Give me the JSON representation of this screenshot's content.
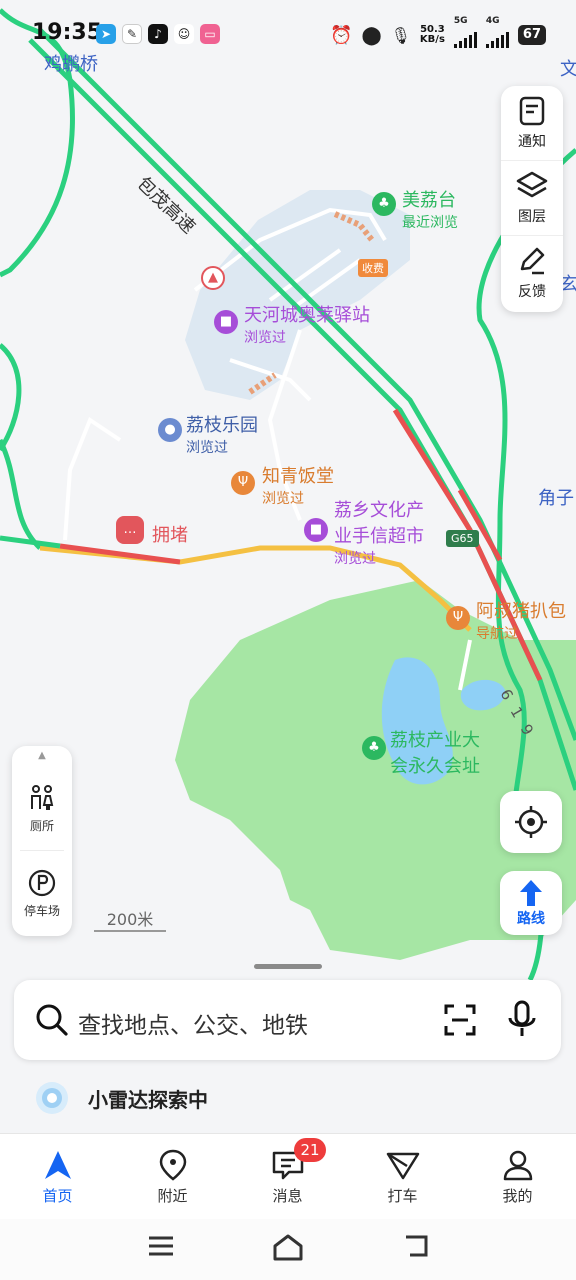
{
  "status_bar": {
    "time": "19:35",
    "network_speed": "50.3",
    "network_unit": "KB/s",
    "signal1": "5G",
    "signal2": "4G",
    "battery": "67"
  },
  "map": {
    "place_labels": {
      "jiye_bridge": "鸡鹕桥",
      "expressway": "包茂高速",
      "meilitai_name": "美荔台",
      "meilitai_sub": "最近浏览",
      "toll": "收费",
      "tianhe_name": "天河城奥莱驿站",
      "tianhe_sub": "浏览过",
      "lizhi_park_name": "荔枝乐园",
      "lizhi_park_sub": "浏览过",
      "zhiqing_name": "知青饭堂",
      "zhiqing_sub": "浏览过",
      "culture_line1": "荔乡文化产",
      "culture_line2": "业手信超市",
      "culture_sub": "浏览过",
      "congestion": "拥堵",
      "g65": "G65",
      "pork_name": "阿叔猪扒包",
      "pork_sub": "导航过",
      "industry_line1": "荔枝产业大",
      "industry_line2": "会永久会址",
      "edge_right_top": "文",
      "edge_right_mid": "玄",
      "edge_right_low": "角子",
      "road_number": "6 1 9"
    },
    "scale": "200米"
  },
  "tools": [
    {
      "label": "通知",
      "icon": "notification-icon"
    },
    {
      "label": "图层",
      "icon": "layers-icon"
    },
    {
      "label": "反馈",
      "icon": "feedback-icon"
    }
  ],
  "side_shortcuts": [
    {
      "label": "厕所",
      "icon": "toilet-icon"
    },
    {
      "label": "停车场",
      "icon": "parking-icon"
    }
  ],
  "route_label": "路线",
  "search": {
    "placeholder": "查找地点、公交、地铁"
  },
  "radar": {
    "text": "小雷达探索中"
  },
  "tabs": [
    {
      "label": "首页",
      "icon": "navigation-arrow-icon",
      "active": true
    },
    {
      "label": "附近",
      "icon": "location-pin-icon"
    },
    {
      "label": "消息",
      "icon": "message-icon",
      "badge": "21"
    },
    {
      "label": "打车",
      "icon": "taxi-icon"
    },
    {
      "label": "我的",
      "icon": "person-icon"
    }
  ],
  "colors": {
    "accent": "#1565f2",
    "road_green": "#2bd07f",
    "road_red": "#e85050",
    "road_yellow": "#f4c042",
    "park_green": "#a6e6a4",
    "water": "#8fd0f6",
    "badge_red": "#ee3c3c"
  }
}
